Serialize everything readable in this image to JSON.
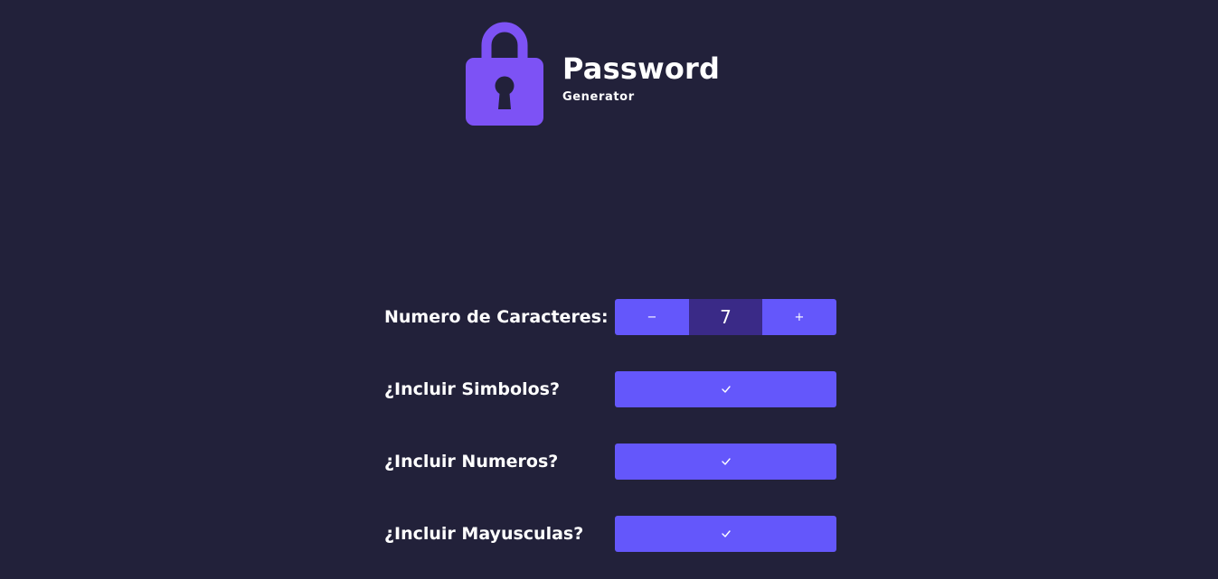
{
  "header": {
    "title": "Password",
    "subtitle": "Generator",
    "logo_icon": "padlock-icon"
  },
  "options": {
    "length": {
      "label": "Numero de Caracteres:",
      "value": "7",
      "decrement_symbol": "−",
      "increment_symbol": "+"
    },
    "symbols": {
      "label": "¿Incluir Simbolos?",
      "checked_symbol": "✓",
      "checked": true
    },
    "numbers": {
      "label": "¿Incluir Numeros?",
      "checked_symbol": "✓",
      "checked": true
    },
    "uppercase": {
      "label": "¿Incluir Mayusculas?",
      "checked_symbol": "✓",
      "checked": true
    }
  },
  "colors": {
    "background": "#22213a",
    "accent": "#6457fb",
    "logo": "#7d52f5",
    "value_box": "#3a2a87"
  }
}
